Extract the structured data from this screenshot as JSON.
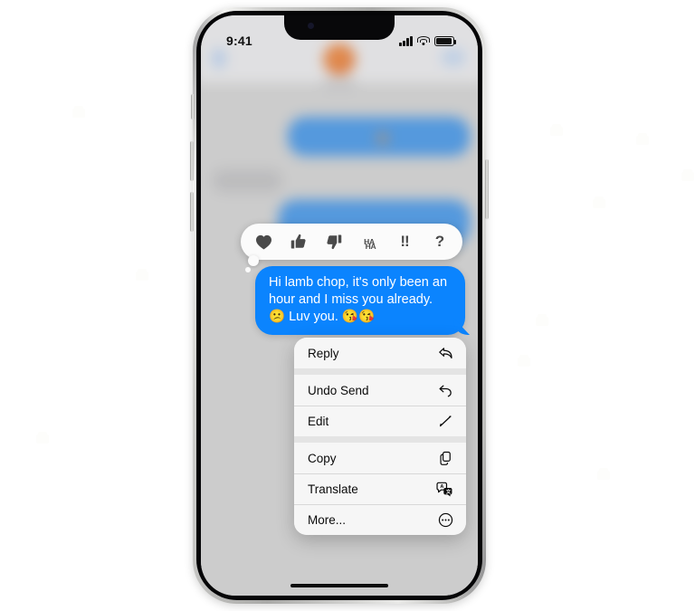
{
  "device": {
    "name": "iphone-13-pro",
    "frame_color": "#c9c9c7",
    "screen_bg": "#d4d4d4"
  },
  "status_bar": {
    "time": "9:41",
    "signal_icon": "cellular-signal-icon",
    "signal_bars": 4,
    "wifi_icon": "wifi-icon",
    "battery_icon": "battery-icon",
    "battery_level_pct": 80
  },
  "nav_bar": {
    "back_icon": "chevron-left-icon",
    "avatar_icon": "contact-avatar",
    "video_icon": "facetime-video-icon",
    "blurred": true
  },
  "conversation": {
    "blurred": true,
    "bubbles": [
      {
        "side": "outgoing",
        "color": "#4295e8"
      },
      {
        "side": "incoming",
        "color": "#c0c0c2"
      },
      {
        "side": "outgoing",
        "color": "#4295e8"
      }
    ]
  },
  "tapback_bar": {
    "visible": true,
    "background": "#fbfbfb",
    "reactions": [
      {
        "id": "heart",
        "icon": "heart-icon",
        "label": "Love"
      },
      {
        "id": "thumbs-up",
        "icon": "thumbs-up-icon",
        "label": "Like"
      },
      {
        "id": "thumbs-down",
        "icon": "thumbs-down-icon",
        "label": "Dislike"
      },
      {
        "id": "haha",
        "icon": "haha-text-icon",
        "label": "HA\nHA",
        "line1": "HA",
        "line2": "HA"
      },
      {
        "id": "exclaim",
        "icon": "double-exclamation-icon",
        "label": "!!"
      },
      {
        "id": "question",
        "icon": "question-mark-icon",
        "label": "?"
      }
    ]
  },
  "message": {
    "side": "outgoing",
    "bubble_color": "#0b84fe",
    "text_color": "#ffffff",
    "text": "Hi lamb chop, it's only been an hour and I miss you already. 😕 Luv you. 😘😘"
  },
  "context_menu": {
    "background": "#f6f6f6",
    "groups": [
      {
        "items": [
          {
            "label": "Reply",
            "icon": "reply-arrow-icon"
          }
        ]
      },
      {
        "items": [
          {
            "label": "Undo Send",
            "icon": "undo-arrow-icon"
          },
          {
            "label": "Edit",
            "icon": "pencil-icon"
          }
        ]
      },
      {
        "items": [
          {
            "label": "Copy",
            "icon": "copy-documents-icon"
          },
          {
            "label": "Translate",
            "icon": "translate-icon"
          },
          {
            "label": "More...",
            "icon": "ellipsis-circle-icon"
          }
        ]
      }
    ]
  },
  "home_indicator": {
    "visible": true,
    "color": "#0d0d0d"
  },
  "page": {
    "background": "#ffffff"
  }
}
